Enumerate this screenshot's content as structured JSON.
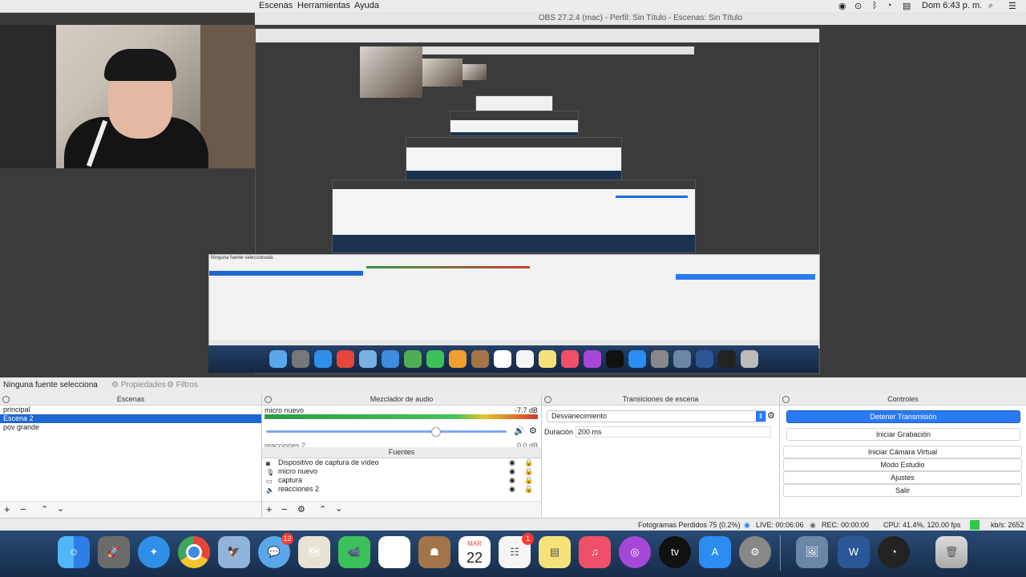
{
  "menubar": {
    "items": [
      "Escenas",
      "Herramientas",
      "Ayuda"
    ],
    "clock": "Dom 6:43 p. m."
  },
  "window": {
    "title": "OBS 27.2.4 (mac) - Perfil: Sin Título - Escenas: Sin Título"
  },
  "preview": {
    "nested_label": "Ninguna fuente seleccionada"
  },
  "toolbar": {
    "no_source": "Ninguna fuente selecciona",
    "properties": "Propiedades",
    "filters": "Filtros"
  },
  "scenes": {
    "title": "Escenas",
    "items": [
      {
        "label": "principal"
      },
      {
        "label": "Escena 2"
      },
      {
        "label": "pov grande"
      }
    ]
  },
  "mixer": {
    "title": "Mezclador de audio",
    "channel": "micro nuevo",
    "level": "-7.7 dB",
    "channel2": "reacciones 2",
    "level2": "0.0 dB",
    "volume": 0.7
  },
  "sources": {
    "title": "Fuentes",
    "items": [
      {
        "label": "Dispositivo de captura de vídeo",
        "icon": "camera-icon"
      },
      {
        "label": "micro nuevo",
        "icon": "microphone-icon"
      },
      {
        "label": "captura",
        "icon": "display-icon"
      },
      {
        "label": "reacciones 2",
        "icon": "speaker-icon"
      }
    ]
  },
  "transitions": {
    "title": "Transiciones de escena",
    "selected": "Desvanecimiento",
    "duration_label": "Duración",
    "duration_value": "200 ms"
  },
  "controls": {
    "title": "Controles",
    "stop_stream": "Detener Transmisión",
    "start_record": "Iniciar Grabación",
    "virtual_cam": "Iniciar Cámara Virtual",
    "studio": "Modo Estudio",
    "settings": "Ajustes",
    "exit": "Salir"
  },
  "status": {
    "dropped": "Fotogramas Perdidos 75 (0.2%)",
    "live": "LIVE: 00:06:06",
    "rec": "REC: 00:00:00",
    "cpu": "CPU: 41.4%, 120.00 fps",
    "kbs": "kb/s: 2652"
  },
  "dock": {
    "messages_badge": "12",
    "reminders_badge": "1",
    "calendar_month": "MAR",
    "calendar_day": "22",
    "tv_label": "tv"
  },
  "colors": {
    "accent": "#2a7af3",
    "selection": "#1d67d2",
    "live_indicator": "#2ec84a"
  }
}
